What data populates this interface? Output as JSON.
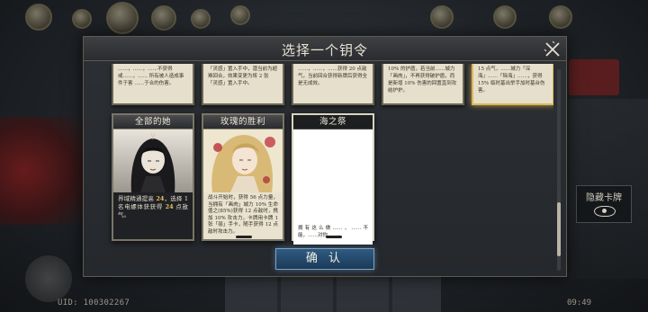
{
  "modal": {
    "title": "选择一个钥令",
    "confirm_label": "确 认"
  },
  "top_cards": [
    {
      "text": "……，……，……不获得或……，…… 所有被人造成事件于害 ……于合的伤害。"
    },
    {
      "text": "「灵感」置入手中，潜当前为超难回合，效果变更为将 2 张「灵感」置入手中。"
    },
    {
      "text": "……，……，……获得 20 点敌气，当前回合获得新牌后获得全是无成效。"
    },
    {
      "text": "10% 的护盾，若当前……城力「画肉」，不再获得破护盾，而是新增 10% 伤害的回置直到攻结护护。"
    },
    {
      "text": "15 点气，……城力「深海」……「除海」……，获得 15% 临时基出举手加时基台伤害。"
    }
  ],
  "cards": [
    {
      "title": "全部的她",
      "desc_pre": "界域精通提高 ",
      "desc_num1": "24",
      "desc_mid": "，选择 1 名电螺体获获得 ",
      "desc_num2": "24",
      "desc_post": " 点敌气。"
    },
    {
      "title": "玫瑰的胜利",
      "desc": "战斗开始时，获得 56 点力量，当拥有「画肉」城力 10% 生命值之(85%)获得 12 点敌时，携加 10% 攻击力，卡牌用卡牌 1 张「丽」手卡，随手获得 12 点敌时攻击力。"
    },
    {
      "title": "海之祭",
      "desc": "拥有这么做……，……不能，……对你……。"
    }
  ],
  "hud": {
    "uid": "UID: 100302267",
    "clock": "09:49",
    "hidden_card_label": "隐藏卡牌"
  }
}
